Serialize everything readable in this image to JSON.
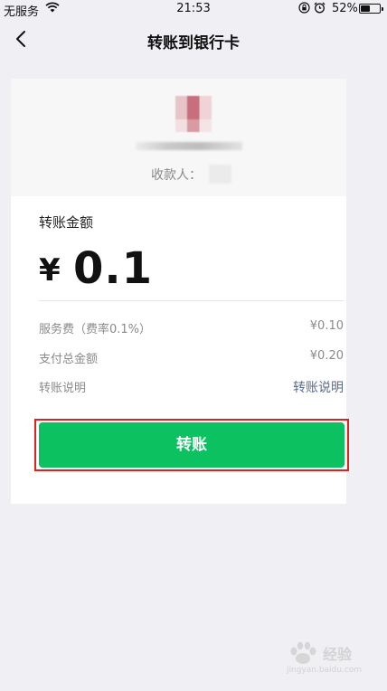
{
  "status_bar": {
    "carrier": "无服务",
    "time": "21:53",
    "battery_percent": "52%",
    "battery_level": 0.52,
    "icons": [
      "wifi-icon",
      "orientation-lock-icon",
      "alarm-icon",
      "battery-icon"
    ]
  },
  "nav": {
    "title": "转账到银行卡",
    "back_icon": "chevron-left-icon"
  },
  "recipient": {
    "payee_label": "收款人："
  },
  "amount": {
    "title": "转账金额",
    "currency_symbol": "¥",
    "value": "0.1"
  },
  "details": [
    {
      "label": "服务费（费率0.1%）",
      "value": "¥0.10"
    },
    {
      "label": "支付总金额",
      "value": "¥0.20"
    },
    {
      "label": "转账说明",
      "value": "转账说明"
    }
  ],
  "actions": {
    "transfer_label": "转账"
  },
  "watermark": {
    "text": "经验",
    "url": "jingyan.baidu.com"
  },
  "colors": {
    "accent_green": "#0cc160",
    "highlight_red": "#e0221f",
    "link_blue": "#576b95"
  }
}
